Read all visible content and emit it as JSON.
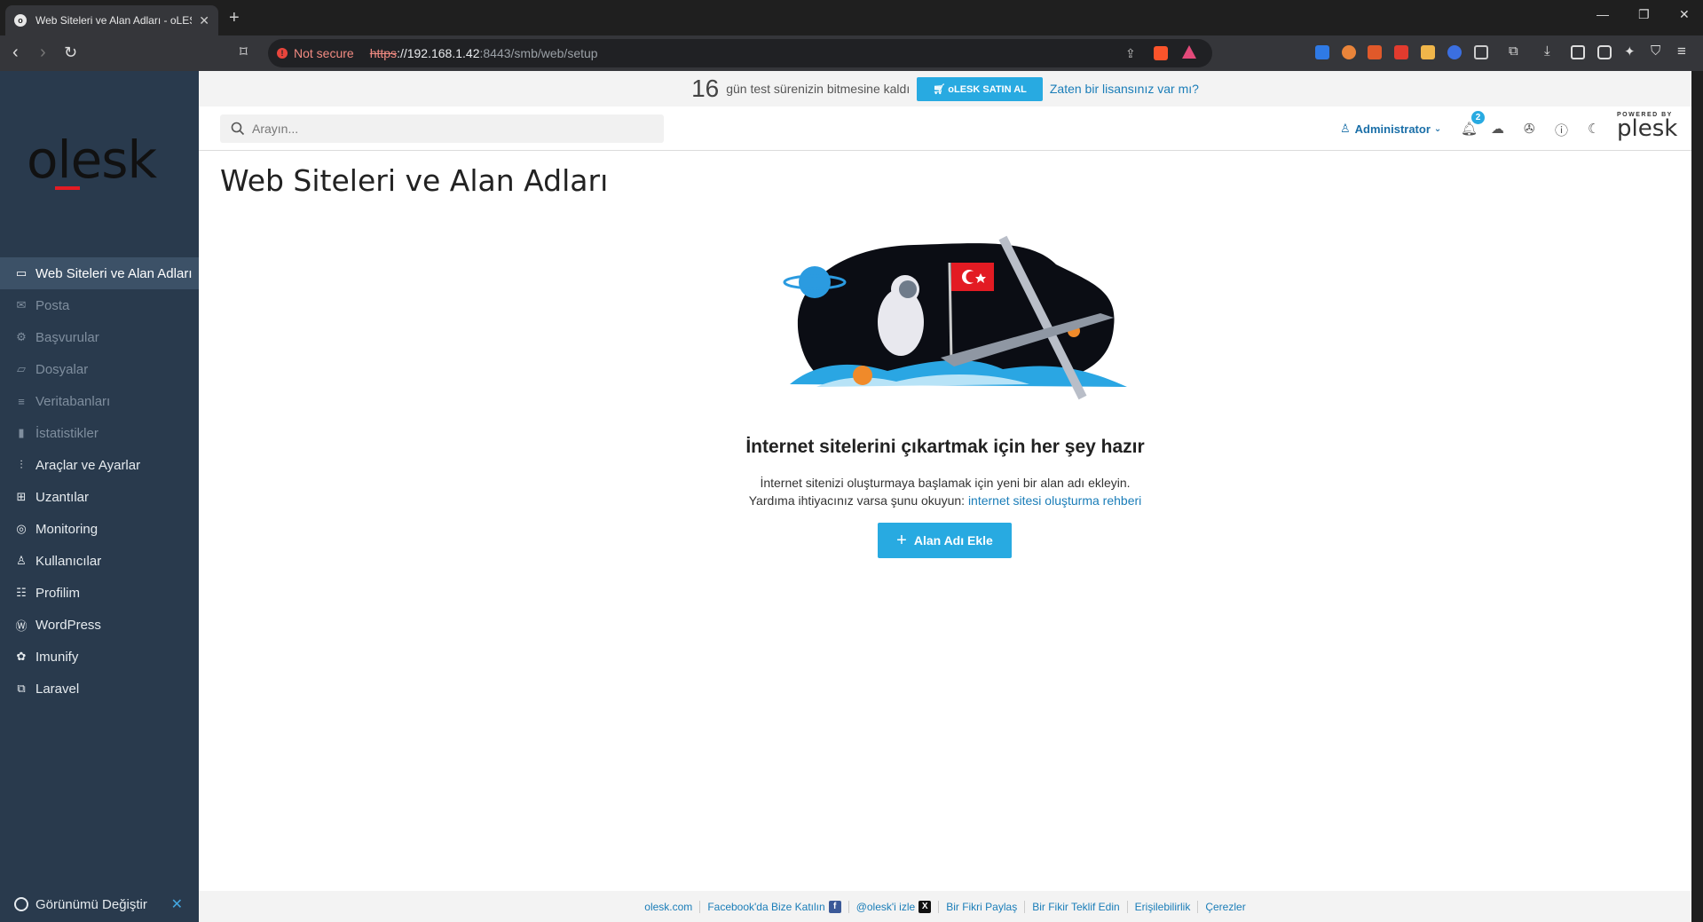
{
  "browser": {
    "tab_title": "Web Siteleri ve Alan Adları - oLES",
    "tab_favicon": "o",
    "security_label": "Not secure",
    "url_scheme": "https",
    "url_host": "://192.168.1.42",
    "url_path": ":8443/smb/web/setup"
  },
  "sidebar": {
    "logo": "olesk",
    "items": [
      {
        "label": "Web Siteleri ve Alan Adları",
        "icon": "monitor-icon",
        "glyph": "▭"
      },
      {
        "label": "Posta",
        "icon": "mail-icon",
        "glyph": "✉"
      },
      {
        "label": "Başvurular",
        "icon": "gear-icon",
        "glyph": "⚙"
      },
      {
        "label": "Dosyalar",
        "icon": "folder-icon",
        "glyph": "▱"
      },
      {
        "label": "Veritabanları",
        "icon": "database-icon",
        "glyph": "≡"
      },
      {
        "label": "İstatistikler",
        "icon": "bar-chart-icon",
        "glyph": "▮"
      },
      {
        "label": "Araçlar ve Ayarlar",
        "icon": "sliders-icon",
        "glyph": "⫶"
      },
      {
        "label": "Uzantılar",
        "icon": "extensions-icon",
        "glyph": "⊞"
      },
      {
        "label": "Monitoring",
        "icon": "monitoring-icon",
        "glyph": "◎"
      },
      {
        "label": "Kullanıcılar",
        "icon": "user-icon",
        "glyph": "♙"
      },
      {
        "label": "Profilim",
        "icon": "profile-icon",
        "glyph": "☷"
      },
      {
        "label": "WordPress",
        "icon": "wordpress-icon",
        "glyph": "Ⓦ"
      },
      {
        "label": "Imunify",
        "icon": "imunify-icon",
        "glyph": "✿"
      },
      {
        "label": "Laravel",
        "icon": "laravel-icon",
        "glyph": "⧉"
      }
    ],
    "view_switch_label": "Görünümü Değiştir"
  },
  "trial": {
    "days": "16",
    "text": "gün test sürenizin bitmesine kaldı",
    "buy_label": "oLESK SATIN AL",
    "license_link": "Zaten bir lisansınız var mı?"
  },
  "topbar": {
    "search_placeholder": "Arayın...",
    "user_label": "Administrator",
    "notifications_count": "2",
    "powered_small": "POWERED BY",
    "powered_brand": "plesk"
  },
  "page": {
    "title": "Web Siteleri ve Alan Adları",
    "empty_title": "İnternet sitelerini çıkartmak için her şey hazır",
    "empty_line1": "İnternet sitenizi oluşturmaya başlamak için yeni bir alan adı ekleyin.",
    "empty_line2": "Yardıma ihtiyacınız varsa şunu okuyun:",
    "empty_link": "internet sitesi oluşturma rehberi",
    "add_button": "Alan Adı Ekle"
  },
  "footer": {
    "links": [
      "olesk.com",
      "Facebook'da Bize Katılın",
      "@olesk'i izle",
      "Bir Fikri Paylaş",
      "Bir Fikir Teklif Edin",
      "Erişilebilirlik",
      "Çerezler"
    ]
  },
  "colors": {
    "accent": "#28aae1",
    "sidebar_bg": "#293a4d",
    "sidebar_active": "#3c5167",
    "link": "#1a7db8",
    "logo_red": "#e31b23"
  }
}
